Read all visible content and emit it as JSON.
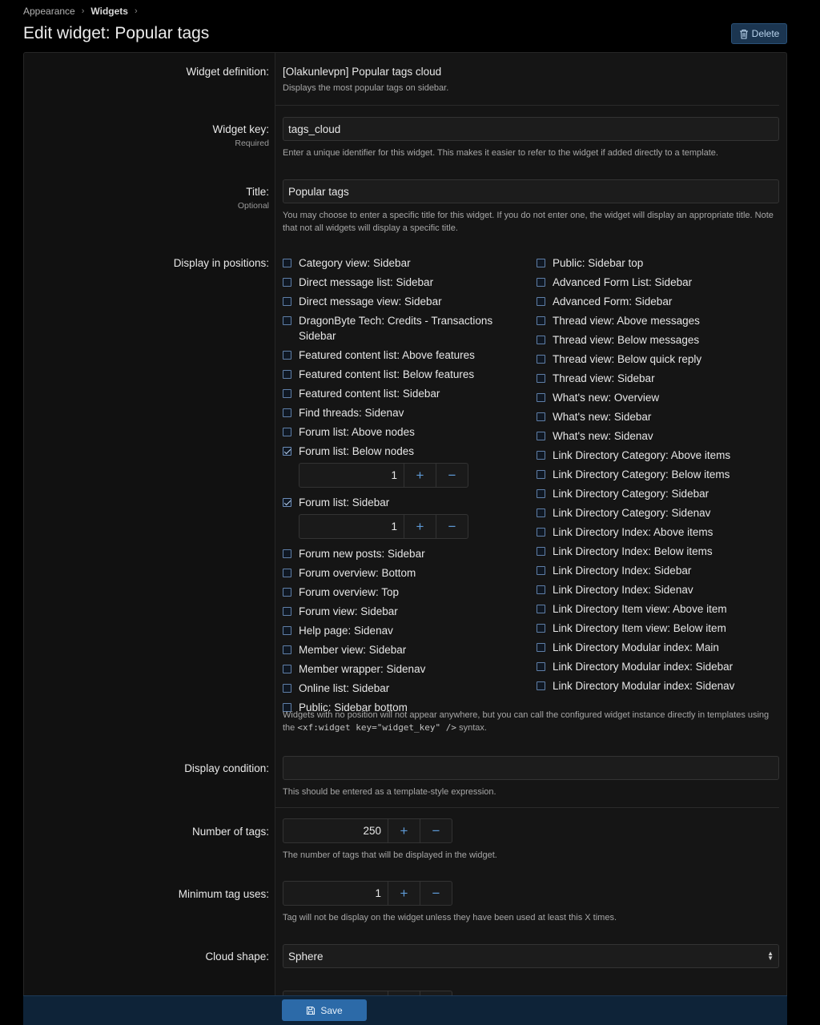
{
  "breadcrumb": {
    "items": [
      "Appearance",
      "Widgets"
    ]
  },
  "page": {
    "title": "Edit widget: Popular tags"
  },
  "actions": {
    "delete_label": "Delete"
  },
  "form": {
    "definition": {
      "label": "Widget definition:",
      "value": "[Olakunlevpn] Popular tags cloud",
      "explain": "Displays the most popular tags on sidebar."
    },
    "widget_key": {
      "label": "Widget key:",
      "hint": "Required",
      "value": "tags_cloud",
      "explain": "Enter a unique identifier for this widget. This makes it easier to refer to the widget if added directly to a template."
    },
    "title": {
      "label": "Title:",
      "hint": "Optional",
      "value": "Popular tags",
      "explain": "You may choose to enter a specific title for this widget. If you do not enter one, the widget will display an appropriate title. Note that not all widgets will display a specific title."
    },
    "positions": {
      "label": "Display in positions:",
      "left": [
        {
          "label": "Category view: Sidebar",
          "checked": false
        },
        {
          "label": "Direct message list: Sidebar",
          "checked": false
        },
        {
          "label": "Direct message view: Sidebar",
          "checked": false
        },
        {
          "label": "DragonByte Tech: Credits - Transactions Sidebar",
          "checked": false
        },
        {
          "label": "Featured content list: Above features",
          "checked": false
        },
        {
          "label": "Featured content list: Below features",
          "checked": false
        },
        {
          "label": "Featured content list: Sidebar",
          "checked": false
        },
        {
          "label": "Find threads: Sidenav",
          "checked": false
        },
        {
          "label": "Forum list: Above nodes",
          "checked": false
        },
        {
          "label": "Forum list: Below nodes",
          "checked": true,
          "order": "1"
        },
        {
          "label": "Forum list: Sidebar",
          "checked": true,
          "order": "1"
        },
        {
          "label": "Forum new posts: Sidebar",
          "checked": false
        },
        {
          "label": "Forum overview: Bottom",
          "checked": false
        },
        {
          "label": "Forum overview: Top",
          "checked": false
        },
        {
          "label": "Forum view: Sidebar",
          "checked": false
        },
        {
          "label": "Help page: Sidenav",
          "checked": false
        },
        {
          "label": "Member view: Sidebar",
          "checked": false
        },
        {
          "label": "Member wrapper: Sidenav",
          "checked": false
        },
        {
          "label": "Online list: Sidebar",
          "checked": false
        },
        {
          "label": "Public: Sidebar bottom",
          "checked": false
        }
      ],
      "right": [
        {
          "label": "Public: Sidebar top",
          "checked": false
        },
        {
          "label": "Advanced Form List: Sidebar",
          "checked": false
        },
        {
          "label": "Advanced Form: Sidebar",
          "checked": false
        },
        {
          "label": "Thread view: Above messages",
          "checked": false
        },
        {
          "label": "Thread view: Below messages",
          "checked": false
        },
        {
          "label": "Thread view: Below quick reply",
          "checked": false
        },
        {
          "label": "Thread view: Sidebar",
          "checked": false
        },
        {
          "label": "What's new: Overview",
          "checked": false
        },
        {
          "label": "What's new: Sidebar",
          "checked": false
        },
        {
          "label": "What's new: Sidenav",
          "checked": false
        },
        {
          "label": "Link Directory Category: Above items",
          "checked": false
        },
        {
          "label": "Link Directory Category: Below items",
          "checked": false
        },
        {
          "label": "Link Directory Category: Sidebar",
          "checked": false
        },
        {
          "label": "Link Directory Category: Sidenav",
          "checked": false
        },
        {
          "label": "Link Directory Index: Above items",
          "checked": false
        },
        {
          "label": "Link Directory Index: Below items",
          "checked": false
        },
        {
          "label": "Link Directory Index: Sidebar",
          "checked": false
        },
        {
          "label": "Link Directory Index: Sidenav",
          "checked": false
        },
        {
          "label": "Link Directory Item view: Above item",
          "checked": false
        },
        {
          "label": "Link Directory Item view: Below item",
          "checked": false
        },
        {
          "label": "Link Directory Modular index: Main",
          "checked": false
        },
        {
          "label": "Link Directory Modular index: Sidebar",
          "checked": false
        },
        {
          "label": "Link Directory Modular index: Sidenav",
          "checked": false
        }
      ],
      "explain_before": "Widgets with no position will not appear anywhere, but you can call the configured widget instance directly in templates using the ",
      "explain_code": "<xf:widget key=\"widget_key\" />",
      "explain_after": " syntax."
    },
    "condition": {
      "label": "Display condition:",
      "value": "",
      "explain": "This should be entered as a template-style expression."
    },
    "num_tags": {
      "label": "Number of tags:",
      "value": "250",
      "explain": "The number of tags that will be displayed in the widget."
    },
    "min_uses": {
      "label": "Minimum tag uses:",
      "value": "1",
      "explain": "Tag will not be display on the widget unless they have been used at least this X times."
    },
    "cloud_shape": {
      "label": "Cloud shape:",
      "value": "Sphere"
    },
    "stepper": {
      "plus": "+",
      "minus": "−"
    }
  },
  "submit": {
    "save_label": "Save"
  }
}
